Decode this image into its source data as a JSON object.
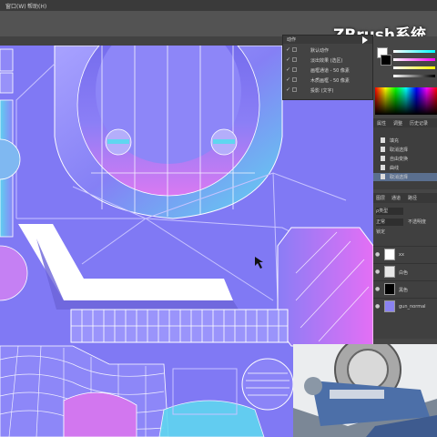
{
  "menu": {
    "items": [
      "窗口(W)",
      "帮助(H)"
    ]
  },
  "watermark": "ZBrush系统教程",
  "actions_panel": {
    "tab": "动作",
    "rows": [
      "默认动作",
      "淡出效果 (选区)",
      "画框通道 - 50 像素",
      "木质画框 - 50 像素",
      "投影 (文字)"
    ]
  },
  "history_panel": {
    "tabs": [
      "属性",
      "调整",
      "历史记录"
    ],
    "rows": [
      "填充",
      "取消选择",
      "自由变换",
      "曲线",
      "取消选择"
    ]
  },
  "layers_panel": {
    "tabs": [
      "图层",
      "通道",
      "路径"
    ],
    "filter": "ρ类型",
    "blend_mode": "正常",
    "opacity_label": "不透明度",
    "lock_label": "锁定",
    "layers": [
      {
        "name": "xx",
        "thumb_color": "#ffffff"
      },
      {
        "name": "白色",
        "thumb_color": "#e8e8e8"
      },
      {
        "name": "黑色",
        "thumb_color": "#000000"
      },
      {
        "name": "gun_normal",
        "thumb_color": "#8a82f0"
      }
    ]
  },
  "colors": {
    "normal_map_base": "#8079f4",
    "normal_map_light": "#a39cff",
    "magenta_edge": "#e36ef5",
    "cyan_edge": "#5fd6f0",
    "panel_bg": "#464646",
    "wireframe": "#ffffff"
  },
  "icons": [
    "eye-icon",
    "checkmark-icon",
    "folder-icon",
    "play-icon",
    "cursor-arrow-icon"
  ]
}
